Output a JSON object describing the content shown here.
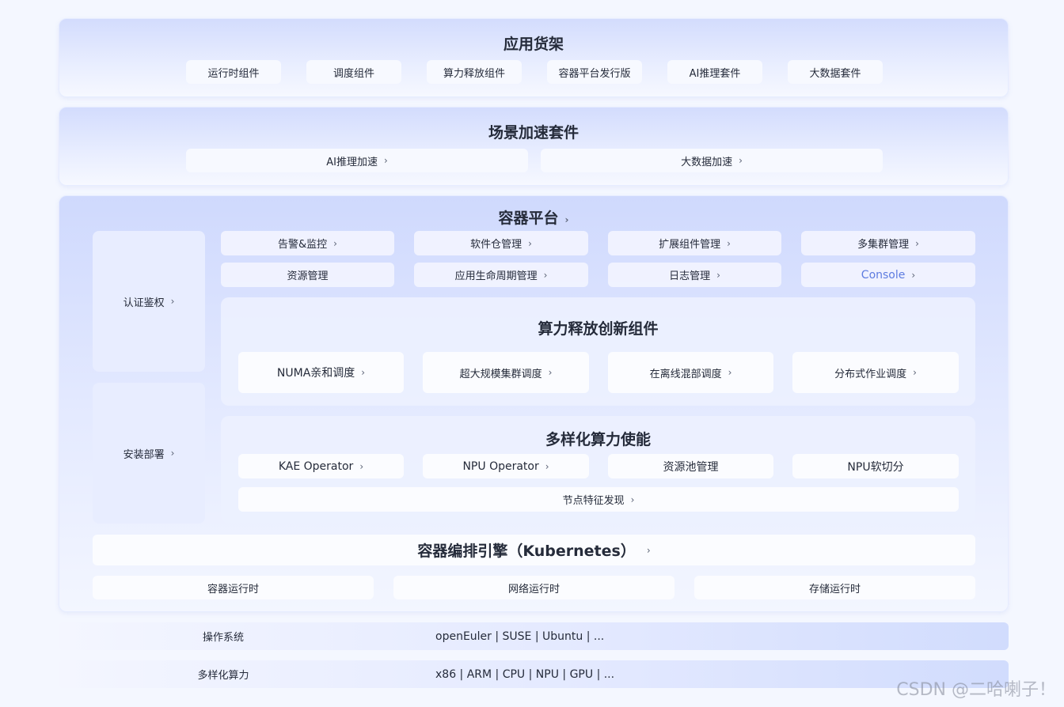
{
  "shelf": {
    "title": "应用货架",
    "items": [
      "运行时组件",
      "调度组件",
      "算力释放组件",
      "容器平台发行版",
      "AI推理套件",
      "大数据套件"
    ]
  },
  "acceleration": {
    "title": "场景加速套件",
    "items": [
      "AI推理加速",
      "大数据加速"
    ]
  },
  "platform": {
    "title": "容器平台",
    "side": [
      "认证鉴权",
      "安装部署"
    ],
    "row1": [
      "告警&监控",
      "软件仓管理",
      "扩展组件管理",
      "多集群管理"
    ],
    "row2": [
      "资源管理",
      "应用生命周期管理",
      "日志管理",
      "Console"
    ],
    "release": {
      "title": "算力释放创新组件",
      "items": [
        "NUMA亲和调度",
        "超大规模集群调度",
        "在离线混部调度",
        "分布式作业调度"
      ]
    },
    "diverse": {
      "title": "多样化算力使能",
      "items": [
        "KAE Operator",
        "NPU Operator",
        "资源池管理",
        "NPU软切分"
      ],
      "node_feature": "节点特征发现"
    },
    "engine": "容器编排引擎（Kubernetes）",
    "runtimes": [
      "容器运行时",
      "网络运行时",
      "存储运行时"
    ]
  },
  "os": {
    "label": "操作系统",
    "value": "openEuler | SUSE | Ubuntu | ..."
  },
  "compute": {
    "label": "多样化算力",
    "value": "x86 | ARM | CPU | NPU | GPU | ..."
  },
  "colors": {
    "link": "#5e7ce0",
    "text": "#252b3a"
  },
  "icons": {
    "chevron": "chevron-right-icon"
  },
  "watermark": "CSDN @二哈喇子！"
}
